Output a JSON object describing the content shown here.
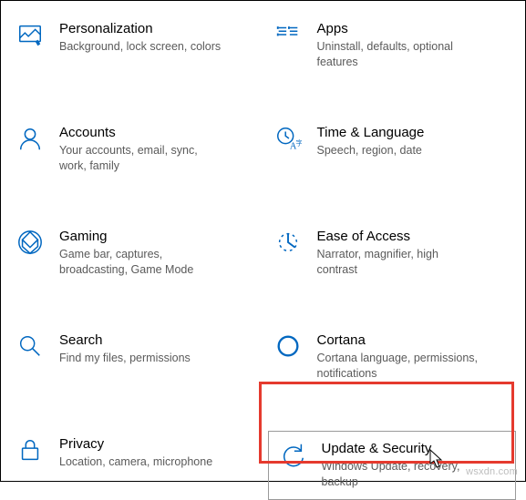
{
  "accent": "#0067C0",
  "items": [
    {
      "title": "Personalization",
      "desc": "Background, lock screen, colors"
    },
    {
      "title": "Apps",
      "desc": "Uninstall, defaults, optional features"
    },
    {
      "title": "Accounts",
      "desc": "Your accounts, email, sync, work, family"
    },
    {
      "title": "Time & Language",
      "desc": "Speech, region, date"
    },
    {
      "title": "Gaming",
      "desc": "Game bar, captures, broadcasting, Game Mode"
    },
    {
      "title": "Ease of Access",
      "desc": "Narrator, magnifier, high contrast"
    },
    {
      "title": "Search",
      "desc": "Find my files, permissions"
    },
    {
      "title": "Cortana",
      "desc": "Cortana language, permissions, notifications"
    },
    {
      "title": "Privacy",
      "desc": "Location, camera, microphone"
    },
    {
      "title": "Update & Security",
      "desc": "Windows Update, recovery, backup"
    }
  ],
  "watermark": "wsxdn.com"
}
